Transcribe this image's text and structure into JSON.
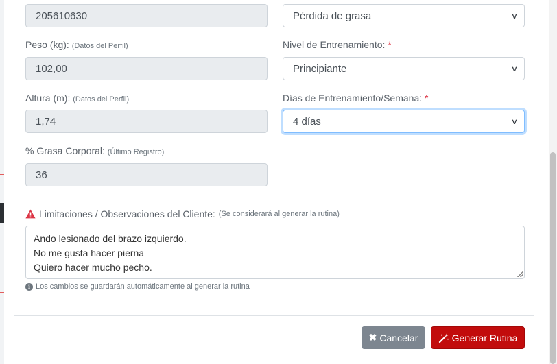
{
  "form": {
    "id_value": "205610630",
    "objective_value": "Pérdida de grasa",
    "peso": {
      "label": "Peso (kg):",
      "hint": "(Datos del Perfil)",
      "value": "102,00"
    },
    "nivel": {
      "label": "Nivel de Entrenamiento:",
      "required": "*",
      "value": "Principiante"
    },
    "altura": {
      "label": "Altura (m):",
      "hint": "(Datos del Perfil)",
      "value": "1,74"
    },
    "dias": {
      "label": "Días de Entrenamiento/Semana:",
      "required": "*",
      "value": "4 días"
    },
    "grasa": {
      "label": "% Grasa Corporal:",
      "hint": "(Último Registro)",
      "value": "36"
    },
    "limitaciones": {
      "label": "Limitaciones / Observaciones del Cliente:",
      "hint": "(Se considerará al generar la rutina)",
      "lines": [
        "Ando lesionado del brazo izquierdo.",
        "No me gusta hacer pierna",
        "Quiero hacer mucho pecho."
      ]
    },
    "autosave_note": "Los cambios se guardarán automáticamente al generar la rutina"
  },
  "footer": {
    "cancel_label": "Cancelar",
    "generate_label": "Generar Rutina"
  },
  "icons": {
    "warning": "warning-triangle-icon",
    "info": "info-circle-icon",
    "cancel": "times-icon",
    "generate": "magic-wand-icon",
    "select_arrow": "chevron-down-icon"
  },
  "colors": {
    "required": "#dc3545",
    "generate_button": "#c20c0c",
    "cancel_button": "#7d8690",
    "readonly_bg": "#e9ecef"
  }
}
